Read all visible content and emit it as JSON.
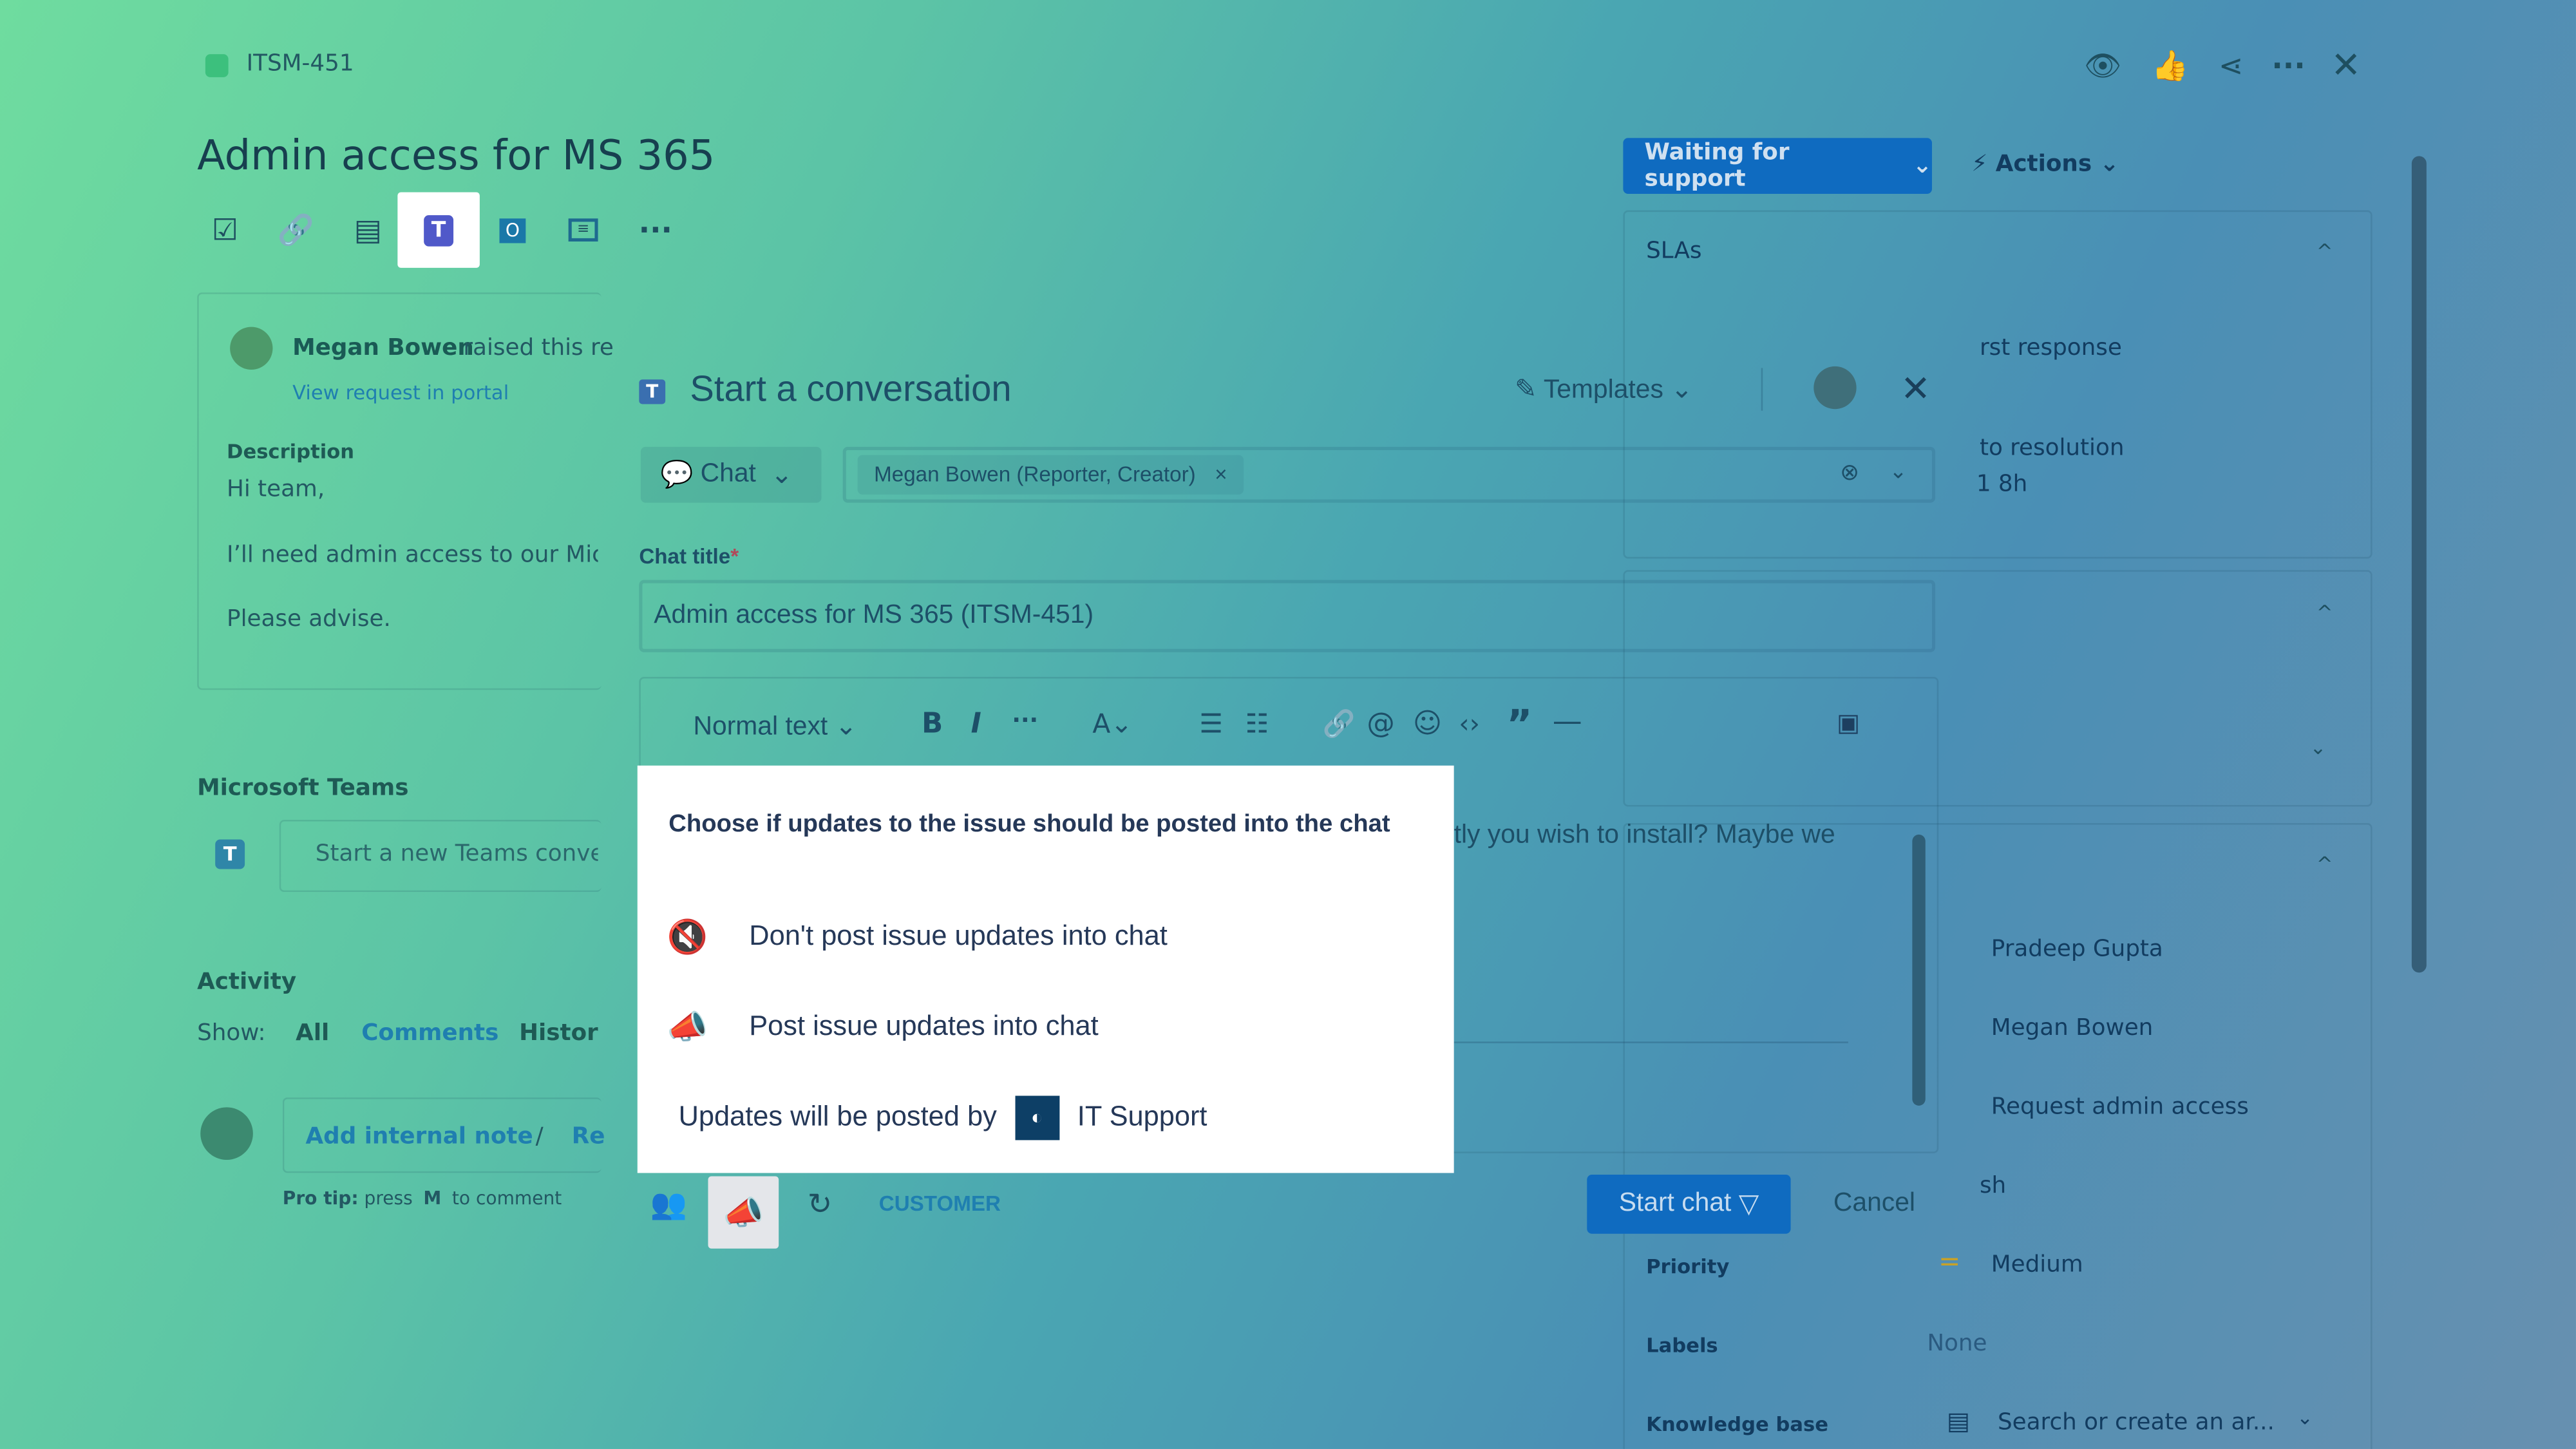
{
  "issue": {
    "key": "ITSM-451",
    "title": "Admin access for MS 365"
  },
  "header_icons": [
    "eye-icon",
    "thumbs-up-icon",
    "share-icon",
    "more-icon",
    "close-icon"
  ],
  "toolbar_icons": [
    "checklist-icon",
    "link-icon",
    "page-icon",
    "teams-icon",
    "outlook-icon",
    "form-icon",
    "more-icon"
  ],
  "request": {
    "reporter": "Megan Bowen",
    "raised_text": "raised this re",
    "portal_link": "View request in portal",
    "description_label": "Description",
    "lines": [
      "Hi team,",
      "I’ll need admin access to our Micr",
      "Please advise."
    ]
  },
  "teams": {
    "heading": "Microsoft Teams",
    "placeholder": "Start a new Teams conver"
  },
  "activity": {
    "heading": "Activity",
    "show_label": "Show:",
    "filters": [
      "All",
      "Comments",
      "History"
    ],
    "active_filter": "Comments",
    "add_note": "Add internal note",
    "separator": "/",
    "reply": "Re",
    "pro_tip": "Pro tip:",
    "press": "press",
    "key": "M",
    "to_comment": "to comment"
  },
  "status": {
    "button": "Waiting for support",
    "actions": "Actions"
  },
  "right_panel": {
    "slas": "SLAs",
    "first_response": "rst response",
    "resolution": "to resolution",
    "resolution_time": "1 8h",
    "assignee": "Pradeep Gupta",
    "reporter": "Megan Bowen",
    "request_type": "Request admin access",
    "partial": "sh",
    "priority_label": "Priority",
    "priority_value": "Medium",
    "labels_label": "Labels",
    "labels_value": "None",
    "kb_label": "Knowledge base",
    "kb_placeholder": "Search or create an ar..."
  },
  "modal": {
    "title": "Start a conversation",
    "templates": "Templates",
    "chat_type": "Chat",
    "recipient": "Megan Bowen (Reporter, Creator)",
    "chat_title_label": "Chat title",
    "required": "*",
    "chat_title_value": "Admin access for MS 365 (ITSM-451)",
    "text_style": "Normal text",
    "body_text": "tly you wish to install? Maybe we",
    "customer_tag": "CUSTOMER",
    "start_chat": "Start chat",
    "cancel": "Cancel"
  },
  "popup": {
    "heading": "Choose if updates to the issue should be posted into the chat",
    "options": [
      {
        "icon": "muted-speaker-icon",
        "label": "Don't post issue updates into chat",
        "color": "#f4511e"
      },
      {
        "icon": "megaphone-icon",
        "label": "Post issue updates into chat",
        "color": "#2f6fd0"
      }
    ],
    "posted_by_label": "Updates will be posted by",
    "poster": "IT Support"
  },
  "colors": {
    "primary": "#0b64c0",
    "popup_bg": "#ffffff",
    "issue_icon": "#36b37e",
    "priority": "#c9a227"
  }
}
